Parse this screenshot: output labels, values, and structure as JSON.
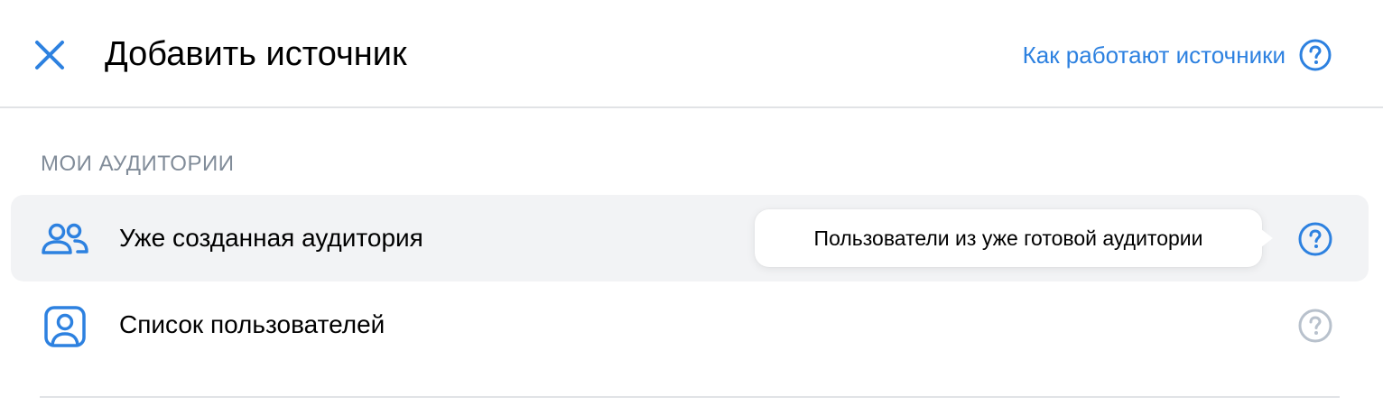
{
  "header": {
    "title": "Добавить источник",
    "help_link": "Как работают источники"
  },
  "section": {
    "title": "МОИ АУДИТОРИИ"
  },
  "items": [
    {
      "label": "Уже созданная аудитория",
      "icon": "users-icon",
      "active": true,
      "tooltip": "Пользователи из уже готовой аудитории"
    },
    {
      "label": "Список пользователей",
      "icon": "user-square-icon",
      "active": false
    }
  ],
  "colors": {
    "accent": "#2d81e0",
    "muted": "#818c99",
    "help_inactive": "#b8c1cc",
    "row_active_bg": "#f2f3f5",
    "divider": "#e1e3e6"
  }
}
